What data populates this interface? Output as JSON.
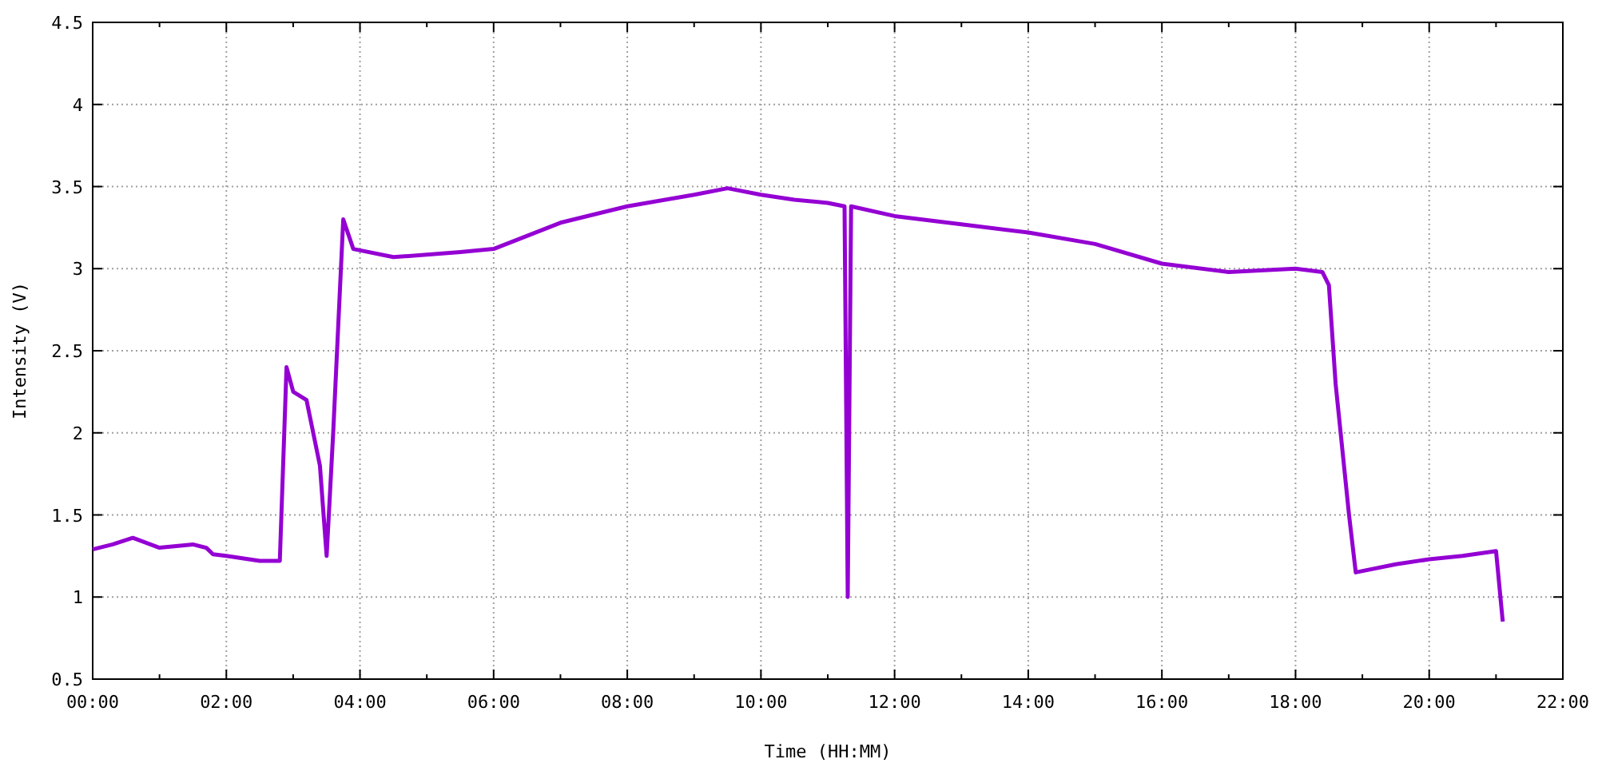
{
  "chart": {
    "chart_data": {
      "type": "line",
      "grid": true,
      "xlabel": "Time (HH:MM)",
      "ylabel": "Intensity (V)",
      "x": [
        0,
        0.3,
        0.6,
        1.0,
        1.5,
        1.7,
        1.8,
        2.0,
        2.5,
        2.8,
        2.9,
        3.0,
        3.2,
        3.4,
        3.5,
        3.6,
        3.75,
        3.9,
        4.5,
        5.5,
        6.0,
        7.0,
        8.0,
        9.0,
        9.5,
        10.0,
        10.5,
        11.0,
        11.25,
        11.3,
        11.35,
        12.0,
        13.0,
        14.0,
        15.0,
        16.0,
        17.0,
        18.0,
        18.4,
        18.5,
        18.6,
        18.8,
        18.9,
        19.5,
        20.0,
        20.5,
        21.0,
        21.1
      ],
      "series": [
        {
          "color": "#9400d3",
          "values": [
            1.29,
            1.32,
            1.36,
            1.3,
            1.32,
            1.3,
            1.26,
            1.25,
            1.22,
            1.22,
            2.4,
            2.25,
            2.2,
            1.8,
            1.25,
            2.0,
            3.3,
            3.12,
            3.07,
            3.1,
            3.12,
            3.28,
            3.38,
            3.45,
            3.49,
            3.45,
            3.42,
            3.4,
            3.38,
            1.0,
            3.38,
            3.32,
            3.27,
            3.22,
            3.15,
            3.03,
            2.98,
            3.0,
            2.98,
            2.9,
            2.3,
            1.5,
            1.15,
            1.2,
            1.23,
            1.25,
            1.28,
            0.85
          ]
        }
      ],
      "xlim": [
        0,
        22
      ],
      "ylim": [
        0.5,
        4.5
      ],
      "xticks": [
        {
          "value": 0,
          "label": "00:00"
        },
        {
          "value": 2,
          "label": "02:00"
        },
        {
          "value": 4,
          "label": "04:00"
        },
        {
          "value": 6,
          "label": "06:00"
        },
        {
          "value": 8,
          "label": "08:00"
        },
        {
          "value": 10,
          "label": "10:00"
        },
        {
          "value": 12,
          "label": "12:00"
        },
        {
          "value": 14,
          "label": "14:00"
        },
        {
          "value": 16,
          "label": "16:00"
        },
        {
          "value": 18,
          "label": "18:00"
        },
        {
          "value": 20,
          "label": "20:00"
        },
        {
          "value": 22,
          "label": "22:00"
        }
      ],
      "yticks": [
        {
          "value": 0.5,
          "label": "0.5"
        },
        {
          "value": 1,
          "label": "1"
        },
        {
          "value": 1.5,
          "label": "1.5"
        },
        {
          "value": 2,
          "label": "2"
        },
        {
          "value": 2.5,
          "label": "2.5"
        },
        {
          "value": 3,
          "label": "3"
        },
        {
          "value": 3.5,
          "label": "3.5"
        },
        {
          "value": 4,
          "label": "4"
        },
        {
          "value": 4.5,
          "label": "4.5"
        }
      ]
    }
  }
}
